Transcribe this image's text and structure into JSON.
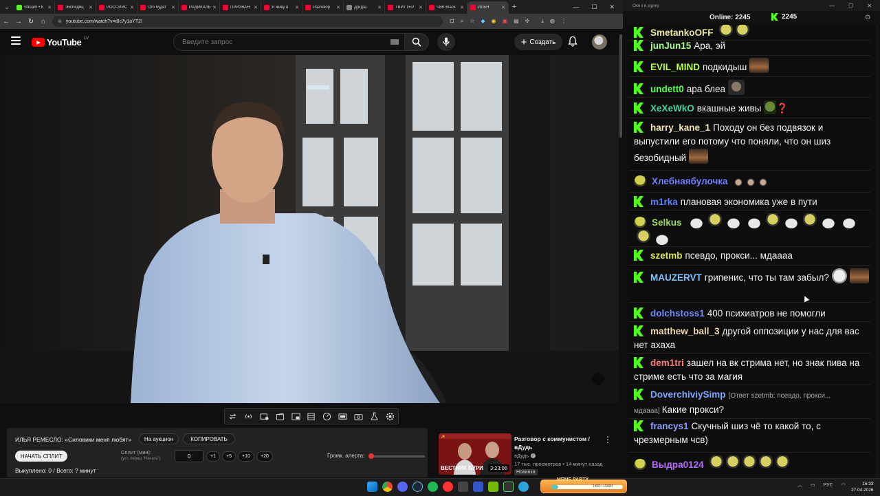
{
  "browser": {
    "tabs": [
      {
        "label": "Stream • К",
        "color": "#53fc18"
      },
      {
        "label": "Экспедиц",
        "color": "#ff0033"
      },
      {
        "label": "РОССИЙС",
        "color": "#ff0033"
      },
      {
        "label": "Что будет",
        "color": "#ff0033"
      },
      {
        "label": "РАДИКАЛЬ",
        "color": "#ff0033"
      },
      {
        "label": "ПРИЗВАН",
        "color": "#ff0033"
      },
      {
        "label": "Я живу в",
        "color": "#ff0033"
      },
      {
        "label": "Разговор",
        "color": "#ff0033"
      },
      {
        "label": "Д(и)ра",
        "color": "#888888"
      },
      {
        "label": "ТВИТТЕР",
        "color": "#ff0033"
      },
      {
        "label": "ЧВК Black",
        "color": "#ff0033"
      },
      {
        "label": "ИЛЬЯ",
        "color": "#ff0033"
      }
    ],
    "url": "youtube.com/watch?v=dIc7y1aYT2I"
  },
  "youtube": {
    "logo_text": "YouTube",
    "logo_region": "LV",
    "search_placeholder": "Введите запрос",
    "create_label": "Создать"
  },
  "extension": {
    "title": "ИЛЬЯ РЕМЕСЛО: «Силовики меня любят»",
    "auction_label": "На аукцион",
    "copy_label": "КОПИРОВАТЬ",
    "start_split_label": "НАЧАТЬ СПЛИТ",
    "split_label": "Сплит (мин):",
    "split_sub": "(уст. перед \"Начать\")",
    "split_value": "0",
    "increments": [
      "+1",
      "+5",
      "+10",
      "+20"
    ],
    "volume_label": "Громк. алерта:",
    "volume_level": 0.02,
    "bought_text": "Выкуплено: 0 / Всего: ? минут"
  },
  "recommended": {
    "title": "Разговор с коммунистом / вДудь",
    "channel": "вДудь",
    "meta": "17 тыс. просмотров • 14 минут назад",
    "badge": "Новинка",
    "duration": "3:23:06",
    "thumb_text": "ВЕСТНИК БУРИ"
  },
  "chat_window": {
    "title": "Окно в дурку",
    "online_label": "Online: 2245",
    "kick_count": "2245"
  },
  "chat": [
    {
      "nick": "SmetankoOFF",
      "color": "#e9e6a0",
      "badge": "kick",
      "text": "",
      "reply": ""
    },
    {
      "nick": "junJun15",
      "color": "#a7ff8a",
      "badge": "kick",
      "text": "Ара, эй",
      "reply": ""
    },
    {
      "nick": "EVIL_MIND",
      "color": "#b8ff3f",
      "badge": "kick",
      "text": "подкидыш",
      "reply": ""
    },
    {
      "nick": "undett0",
      "color": "#5aff5a",
      "badge": "kick",
      "text": "ара блеа",
      "reply": ""
    },
    {
      "nick": "XeXeWkO",
      "color": "#45d39b",
      "badge": "kick",
      "text": "вкашные живы",
      "reply": ""
    },
    {
      "nick": "harry_kane_1",
      "color": "#f3e6b0",
      "badge": "kick",
      "text": "Походу он без подвязок и выпустили его потому что поняли, что он шиз безобидный",
      "reply": ""
    },
    {
      "nick": "Хлебнаябулочка",
      "color": "#6b7fff",
      "badge": "pepe",
      "text": "",
      "reply": ""
    },
    {
      "nick": "m1rka",
      "color": "#5b7cff",
      "badge": "kick",
      "text": "плановая экономика уже в пути",
      "reply": ""
    },
    {
      "nick": "Selkus",
      "color": "#9bd85a",
      "badge": "pepe",
      "text": "",
      "reply": ""
    },
    {
      "nick": "szetmb",
      "color": "#d7e84a",
      "badge": "kick",
      "text": "псевдо, прокси... мдаааа",
      "reply": ""
    },
    {
      "nick": "MAUZERVT",
      "color": "#7fc3ff",
      "badge": "kick",
      "text": "грипенис, что ты там забыл?",
      "reply": ""
    },
    {
      "nick": "dolchstoss1",
      "color": "#6f8dff",
      "badge": "kick",
      "text": "400 психиатров не помогли",
      "reply": ""
    },
    {
      "nick": "matthew_ball_3",
      "color": "#e9d6b0",
      "badge": "kick",
      "text": "другой оппозиции у нас для вас нет ахаха",
      "reply": ""
    },
    {
      "nick": "dem1tri",
      "color": "#ff7b7b",
      "badge": "kick",
      "text": "зашел на вк стрима нет, но знак пива на стриме есть что за магия",
      "reply": ""
    },
    {
      "nick": "DoverchiviySimp",
      "color": "#7fa6ff",
      "badge": "kick",
      "text": "Какие прокси?",
      "reply": "[Ответ szetmb: псевдо, прокси... мдаааа]"
    },
    {
      "nick": "francys1",
      "color": "#8aa0ff",
      "badge": "kick",
      "text": "Скучный шиз чё то какой то, с чрезмерным чсв)",
      "reply": ""
    },
    {
      "nick": "Выдра0124",
      "color": "#b56bff",
      "badge": "pepe",
      "text": "",
      "reply": ""
    }
  ],
  "taskbar": {
    "meme_title": "MEME PARTY",
    "meme_value": "1400 / 15000",
    "meme_progress": 0.093,
    "lang": "РУС",
    "time": "16:33",
    "date": "27.04.2026"
  },
  "colors": {
    "kick": "#53fc18",
    "yt_red": "#ff0000"
  }
}
